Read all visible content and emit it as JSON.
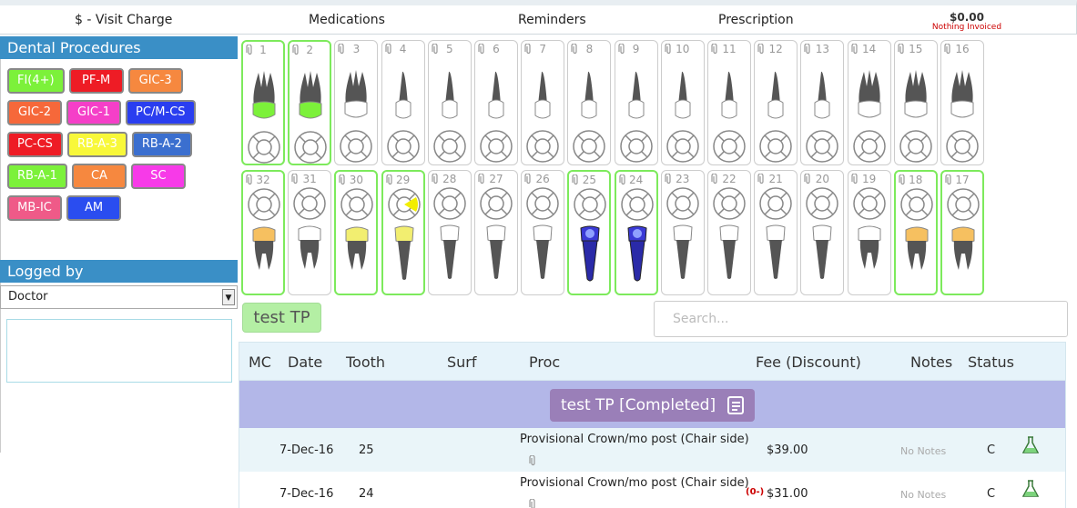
{
  "topbar": {
    "visit": "$ - Visit Charge",
    "medications": "Medications",
    "reminders": "Reminders",
    "prescription": "Prescription",
    "total": "$0.00",
    "invoice_status": "Nothing Invoiced"
  },
  "procedures": {
    "title": "Dental Procedures",
    "items": [
      {
        "label": "FI(4+)",
        "bg": "#7cf13a",
        "fg": "#fff"
      },
      {
        "label": "PF-M",
        "bg": "#ee1c25",
        "fg": "#fff"
      },
      {
        "label": "GIC-3",
        "bg": "#f6883f",
        "fg": "#fff"
      },
      {
        "label": "GIC-2",
        "bg": "#f6683a",
        "fg": "#fff"
      },
      {
        "label": "GIC-1",
        "bg": "#f53fc8",
        "fg": "#fff"
      },
      {
        "label": "PC/M-CS",
        "bg": "#2a3ef0",
        "fg": "#fff"
      },
      {
        "label": "PC-CS",
        "bg": "#ee1c25",
        "fg": "#fff"
      },
      {
        "label": "RB-A-3",
        "bg": "#f8f83a",
        "fg": "#fff"
      },
      {
        "label": "RB-A-2",
        "bg": "#3b6fcf",
        "fg": "#fff"
      },
      {
        "label": "RB-A-1",
        "bg": "#7cf13a",
        "fg": "#fff"
      },
      {
        "label": "CA",
        "bg": "#f6883f",
        "fg": "#fff"
      },
      {
        "label": "SC",
        "bg": "#f73ae8",
        "fg": "#fff"
      },
      {
        "label": "MB-IC",
        "bg": "#ef5a88",
        "fg": "#fff"
      },
      {
        "label": "AM",
        "bg": "#2a4df0",
        "fg": "#fff"
      }
    ]
  },
  "logged": {
    "title": "Logged by",
    "selected": "Doctor"
  },
  "upper_teeth": [
    "1",
    "2",
    "3",
    "4",
    "5",
    "6",
    "7",
    "8",
    "9",
    "10",
    "11",
    "12",
    "13",
    "14",
    "15",
    "16"
  ],
  "lower_teeth": [
    "32",
    "31",
    "30",
    "29",
    "28",
    "27",
    "26",
    "25",
    "24",
    "23",
    "22",
    "21",
    "20",
    "19",
    "18",
    "17"
  ],
  "treatment_plan": {
    "button": "test TP",
    "search_placeholder": "Search..."
  },
  "table": {
    "headers": {
      "mc": "MC",
      "date": "Date",
      "tooth": "Tooth",
      "surf": "Surf",
      "proc": "Proc",
      "fee": "Fee (Discount)",
      "notes": "Notes",
      "status": "Status"
    },
    "group": "test TP [Completed]",
    "rows": [
      {
        "date": "7-Dec-16",
        "tooth": "25",
        "proc": "Provisional Crown/mo post (Chair side)",
        "discount": "",
        "fee": "$39.00",
        "notes": "No Notes",
        "status": "C"
      },
      {
        "date": "7-Dec-16",
        "tooth": "24",
        "proc": "Provisional Crown/mo post (Chair side)",
        "discount": "(0-)",
        "fee": "$31.00",
        "notes": "No Notes",
        "status": "C"
      }
    ]
  }
}
